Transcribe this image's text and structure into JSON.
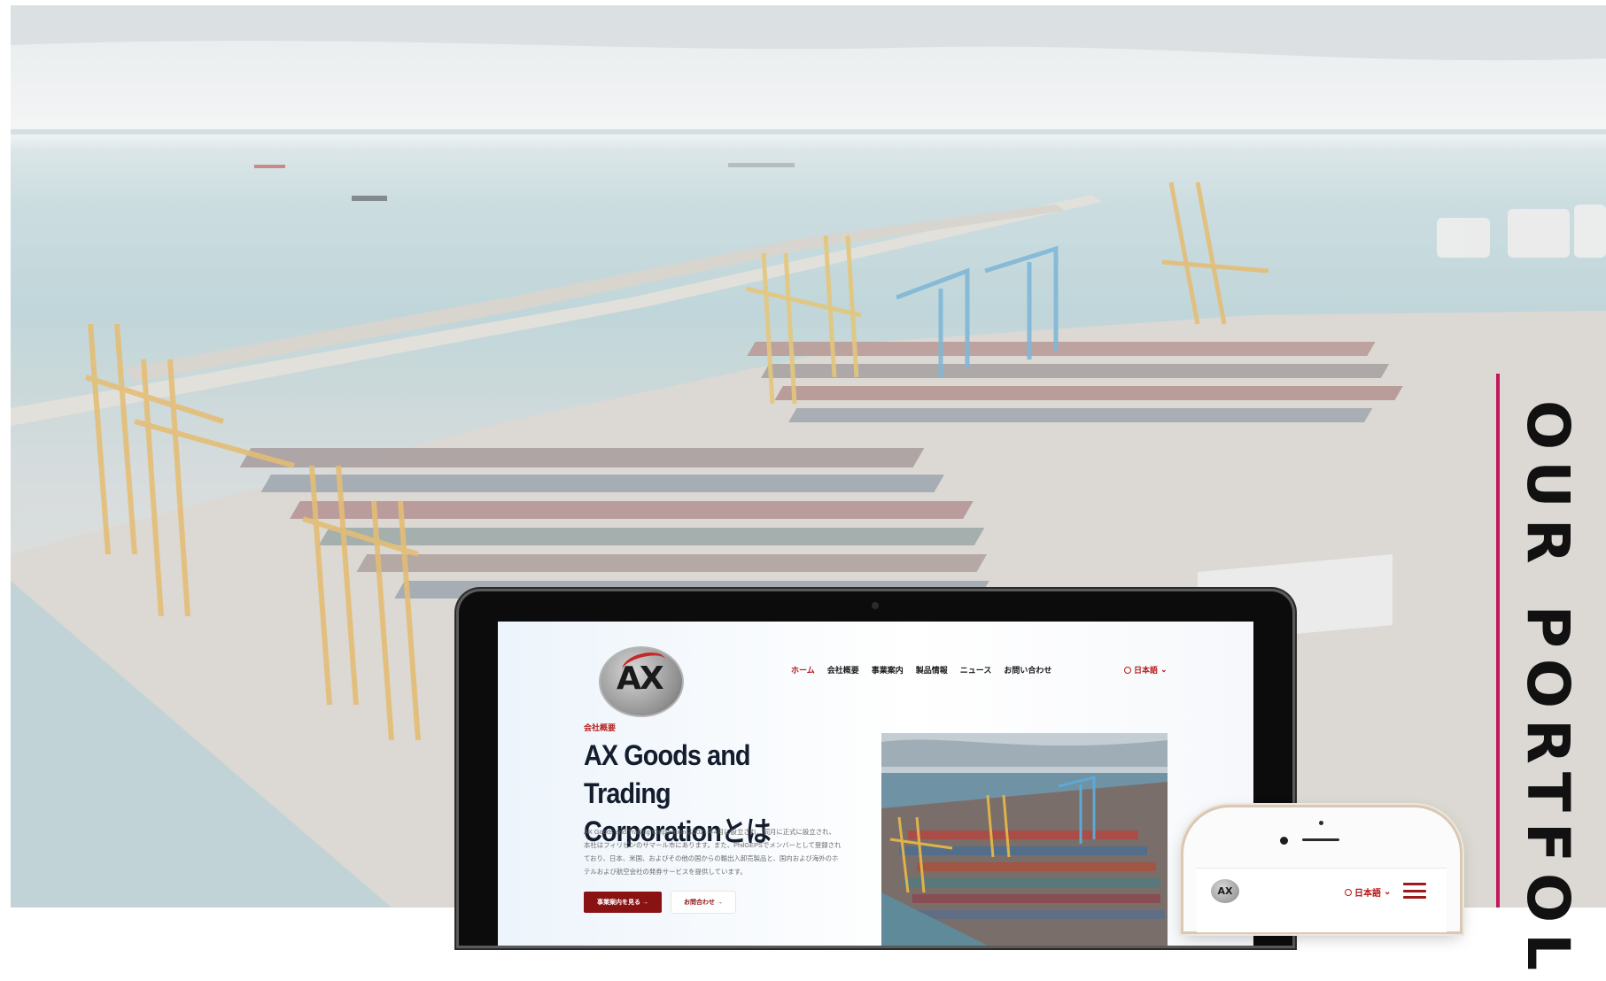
{
  "section": {
    "vertical_title": "OUR PORTFOL",
    "accent_color": "#c2185b"
  },
  "mock_site": {
    "logo_text": "AX",
    "nav_items": [
      "ホーム",
      "会社概要",
      "事業案内",
      "製品情報",
      "ニュース",
      "お問い合わせ"
    ],
    "language": "日本語",
    "eyebrow": "会社概要",
    "heading_line1": "AX Goods and Trading",
    "heading_line2": "Corporationとは",
    "body_lines": [
      "AX Goods and Trading Corporationは2021年4月に設立され、同月に正式に設立され、",
      "本社はフィリピンのサマール市にあります。また、PhilGEPSでメンバーとして登録され",
      "ており、日本、米国、およびその他の国からの輸出入卸売製品と、国内および海外のホ",
      "テルおよび航空会社の発券サービスを提供しています。"
    ],
    "primary_button": "事業案内を見る →",
    "secondary_button": "お問合わせ →",
    "brand_color": "#8b1212"
  },
  "mock_phone": {
    "logo_text": "AX",
    "language": "日本語"
  }
}
